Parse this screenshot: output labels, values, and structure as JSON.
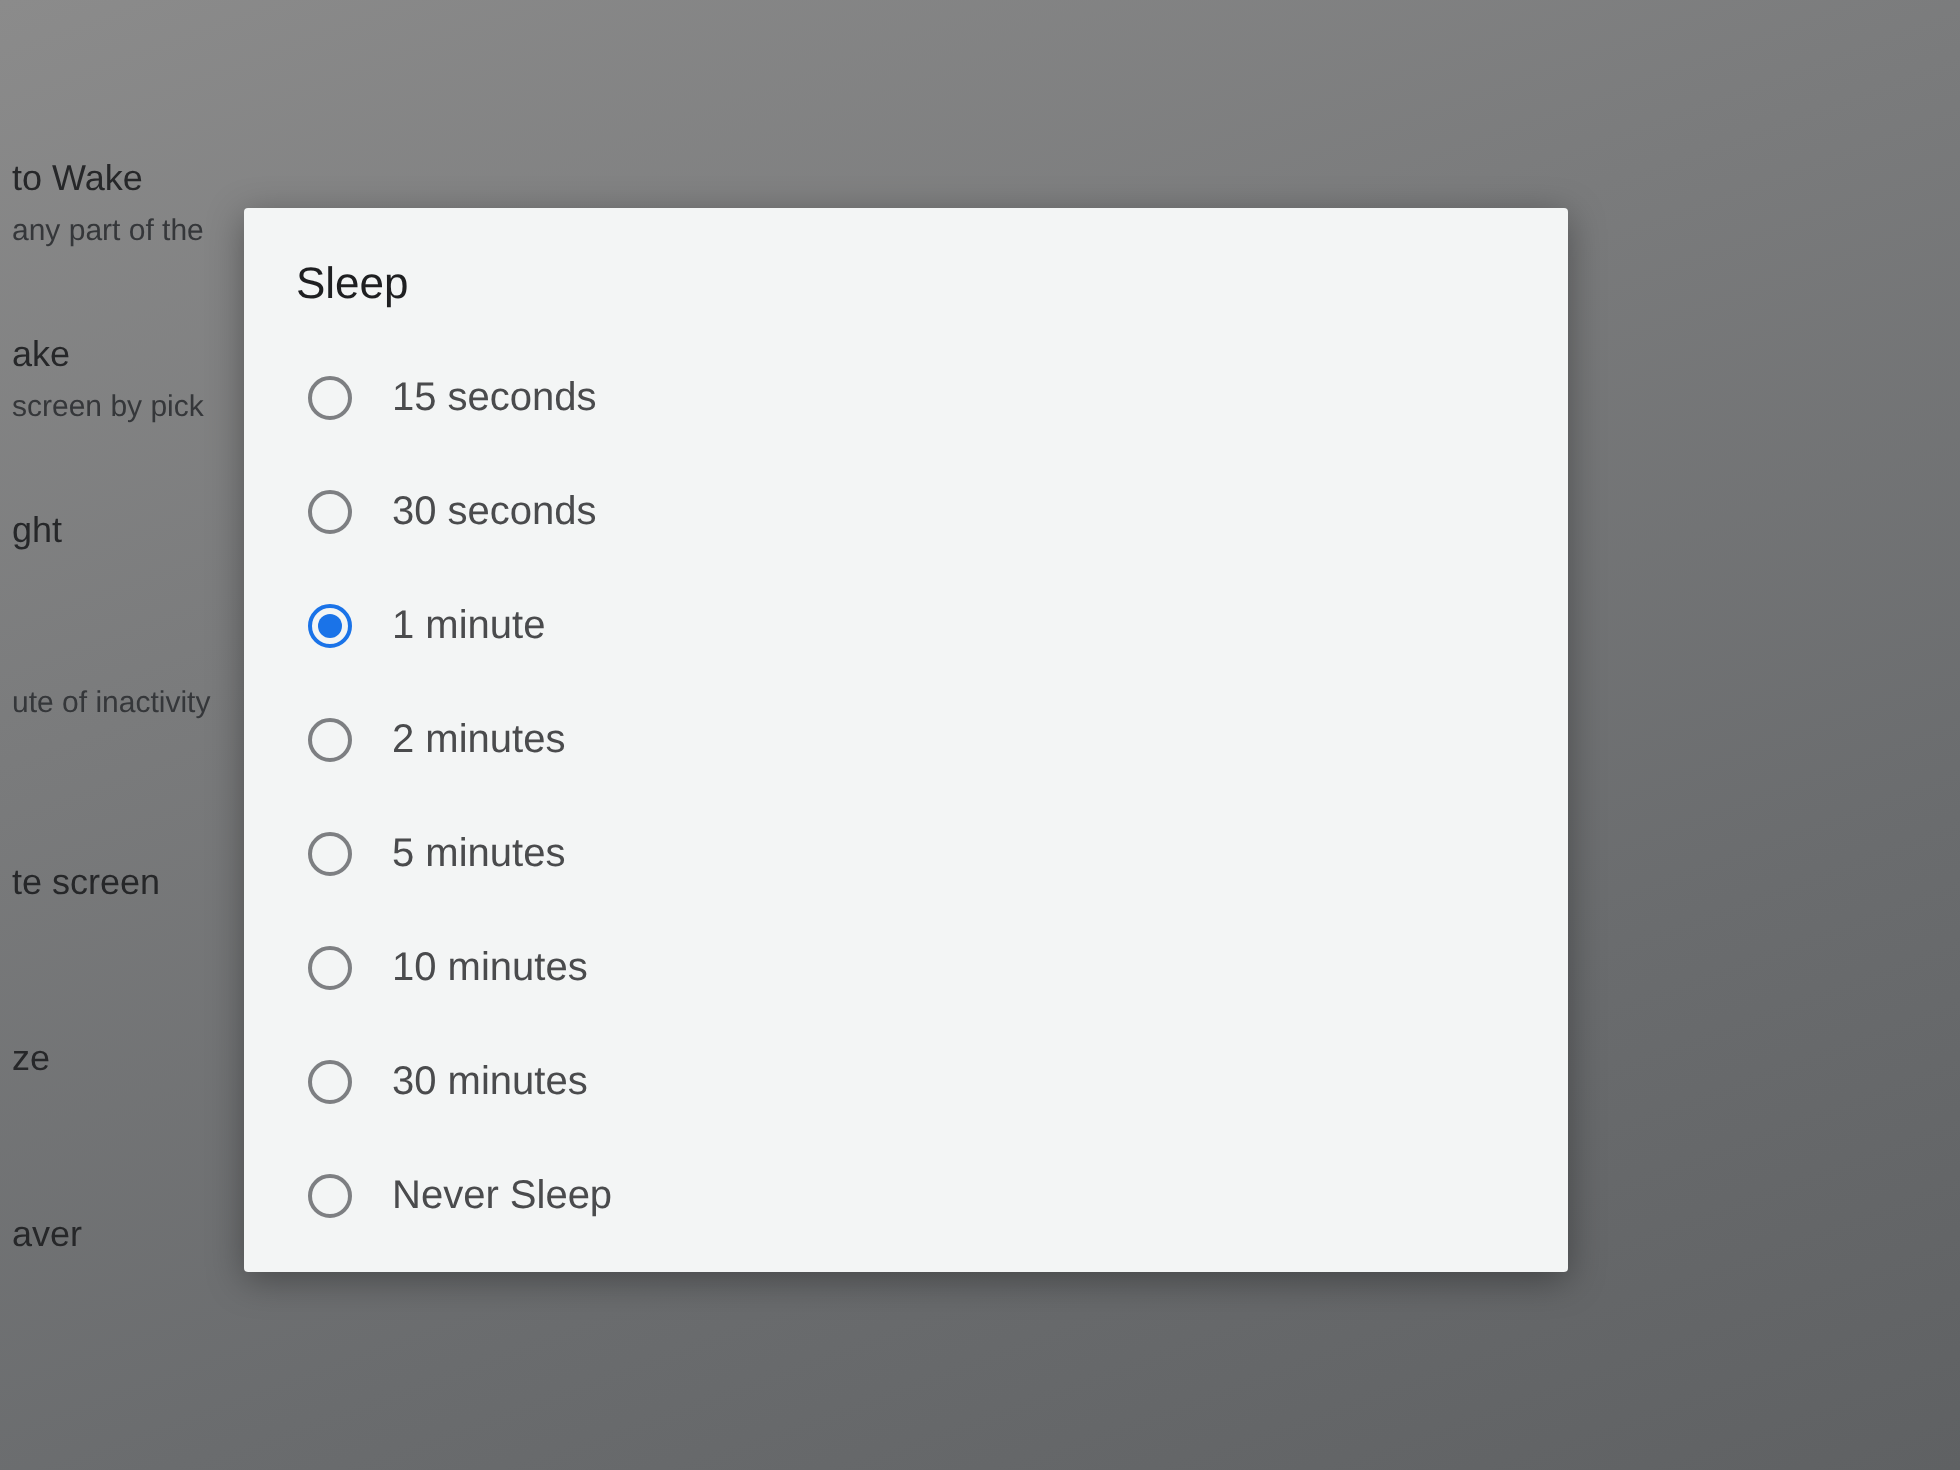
{
  "settings_background": {
    "rows": [
      {
        "title": "to Wake",
        "subtitle": "any part of the"
      },
      {
        "title": "ake",
        "subtitle": "screen by pick"
      },
      {
        "title": "ght"
      },
      {
        "subtitle": "ute of inactivity"
      },
      {
        "title": "te screen"
      },
      {
        "title": "ze"
      },
      {
        "title": "aver"
      }
    ]
  },
  "sleep_dialog": {
    "title": "Sleep",
    "options": [
      {
        "label": "15 seconds",
        "selected": false
      },
      {
        "label": "30 seconds",
        "selected": false
      },
      {
        "label": "1 minute",
        "selected": true
      },
      {
        "label": "2 minutes",
        "selected": false
      },
      {
        "label": "5 minutes",
        "selected": false
      },
      {
        "label": "10 minutes",
        "selected": false
      },
      {
        "label": "30 minutes",
        "selected": false
      },
      {
        "label": "Never Sleep",
        "selected": false
      }
    ]
  }
}
